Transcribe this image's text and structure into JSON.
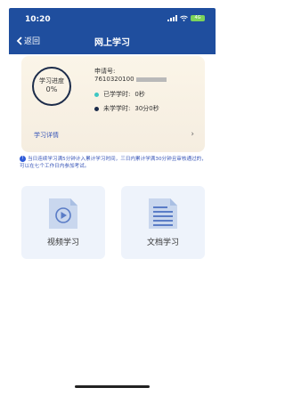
{
  "status_bar": {
    "time": "10:20",
    "battery": "4G"
  },
  "header": {
    "back_label": "返回",
    "title": "网上学习"
  },
  "progress": {
    "ring_label": "学习进度",
    "ring_value": "0%",
    "apply_label": "申请号:",
    "apply_number": "7610320100",
    "studied_label": "已学学时:",
    "studied_value": "0秒",
    "remaining_label": "未学学时:",
    "remaining_value": "30分0秒",
    "detail_link": "学习详情",
    "colors": {
      "studied_dot": "#3ec7c3",
      "remaining_dot": "#1c2c4a"
    }
  },
  "notice": {
    "text": "当日连续学习满5分钟计入累计学习时间，三日内累计学满30分钟且审核通过的，可以在七个工作日内参加考试。"
  },
  "cards": [
    {
      "label": "视频学习",
      "icon": "video-play-icon"
    },
    {
      "label": "文档学习",
      "icon": "document-icon"
    }
  ],
  "colors": {
    "header_bg": "#1f4e9e",
    "accent": "#3a57b8"
  }
}
